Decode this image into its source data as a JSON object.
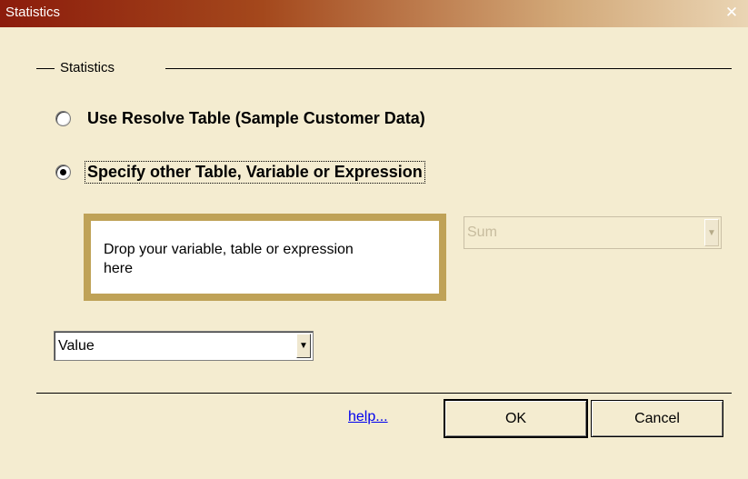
{
  "window": {
    "title": "Statistics",
    "close_glyph": "✕"
  },
  "group": {
    "label": "Statistics"
  },
  "options": [
    {
      "label": "Use Resolve Table (Sample Customer Data)",
      "checked": false
    },
    {
      "label": "Specify other Table, Variable or Expression",
      "checked": true
    }
  ],
  "dropzone": {
    "text": "Drop your variable, table or expression here"
  },
  "aggregate_select": {
    "value": "Sum",
    "enabled": false
  },
  "field_select": {
    "value": "Value"
  },
  "footer": {
    "help_label": "help...",
    "ok_label": "OK",
    "cancel_label": "Cancel"
  },
  "colors": {
    "dropzone_border": "#bfa257",
    "dialog_background": "#f4ecd0",
    "title_gradient_start": "#8c1c0c"
  }
}
